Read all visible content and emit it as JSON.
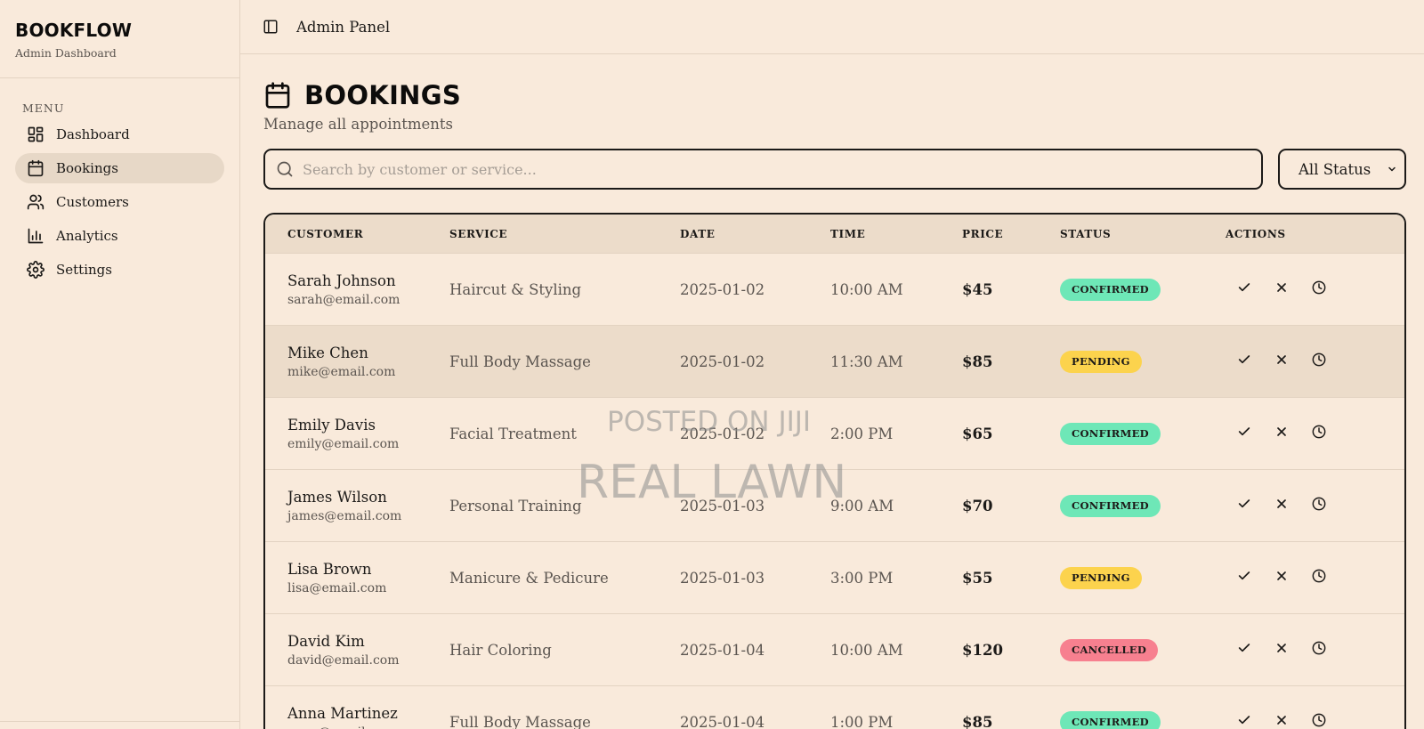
{
  "brand": {
    "name": "BOOKFLOW",
    "subtitle": "Admin Dashboard"
  },
  "sidebar": {
    "menu_label": "MENU",
    "items": [
      {
        "label": "Dashboard",
        "icon": "dashboard-icon",
        "active": false
      },
      {
        "label": "Bookings",
        "icon": "calendar-icon",
        "active": true
      },
      {
        "label": "Customers",
        "icon": "users-icon",
        "active": false
      },
      {
        "label": "Analytics",
        "icon": "bar-chart-icon",
        "active": false
      },
      {
        "label": "Settings",
        "icon": "gear-icon",
        "active": false
      }
    ]
  },
  "topbar": {
    "title": "Admin Panel",
    "toggle_icon": "sidebar-toggle-icon"
  },
  "page": {
    "title": "BOOKINGS",
    "subtitle": "Manage all appointments",
    "icon": "calendar-icon"
  },
  "filters": {
    "search_placeholder": "Search by customer or service...",
    "search_value": "",
    "status_selected": "All Status"
  },
  "table": {
    "columns": [
      "CUSTOMER",
      "SERVICE",
      "DATE",
      "TIME",
      "PRICE",
      "STATUS",
      "ACTIONS"
    ],
    "rows": [
      {
        "name": "Sarah Johnson",
        "email": "sarah@email.com",
        "service": "Haircut & Styling",
        "date": "2025-01-02",
        "time": "10:00 AM",
        "price": "$45",
        "status": "CONFIRMED"
      },
      {
        "name": "Mike Chen",
        "email": "mike@email.com",
        "service": "Full Body Massage",
        "date": "2025-01-02",
        "time": "11:30 AM",
        "price": "$85",
        "status": "PENDING"
      },
      {
        "name": "Emily Davis",
        "email": "emily@email.com",
        "service": "Facial Treatment",
        "date": "2025-01-02",
        "time": "2:00 PM",
        "price": "$65",
        "status": "CONFIRMED"
      },
      {
        "name": "James Wilson",
        "email": "james@email.com",
        "service": "Personal Training",
        "date": "2025-01-03",
        "time": "9:00 AM",
        "price": "$70",
        "status": "CONFIRMED"
      },
      {
        "name": "Lisa Brown",
        "email": "lisa@email.com",
        "service": "Manicure & Pedicure",
        "date": "2025-01-03",
        "time": "3:00 PM",
        "price": "$55",
        "status": "PENDING"
      },
      {
        "name": "David Kim",
        "email": "david@email.com",
        "service": "Hair Coloring",
        "date": "2025-01-04",
        "time": "10:00 AM",
        "price": "$120",
        "status": "CANCELLED"
      },
      {
        "name": "Anna Martinez",
        "email": "anna@email.com",
        "service": "Full Body Massage",
        "date": "2025-01-04",
        "time": "1:00 PM",
        "price": "$85",
        "status": "CONFIRMED"
      }
    ]
  },
  "colors": {
    "background": "#f9eadb",
    "confirmed": "#6ee7b7",
    "pending": "#fcd34d",
    "cancelled": "#f7808f"
  },
  "watermark": {
    "line1": "POSTED ON JIJI",
    "line2": "REAL LAWN"
  }
}
